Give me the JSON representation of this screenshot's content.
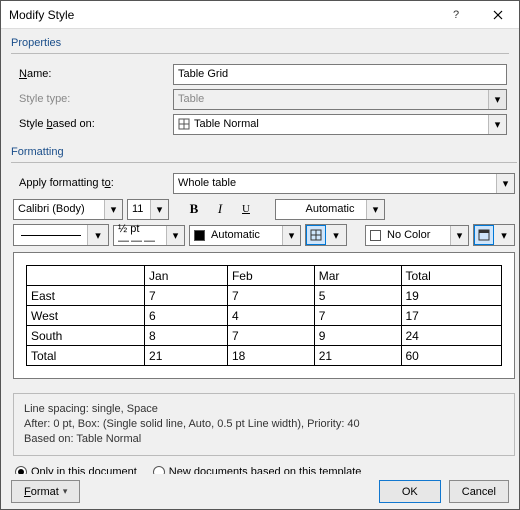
{
  "title": "Modify Style",
  "sections": {
    "properties": "Properties",
    "formatting": "Formatting"
  },
  "fields": {
    "name_label_pre": "N",
    "name_label_rest": "ame:",
    "name_value": "Table Grid",
    "type_label": "Style type:",
    "type_value": "Table",
    "based_label_pre": "Style ",
    "based_label_u": "b",
    "based_label_rest": "ased on:",
    "based_value": "Table Normal",
    "apply_label_pre": "Apply formatting t",
    "apply_label_u": "o",
    "apply_label_rest": ":",
    "apply_value": "Whole table"
  },
  "font": {
    "family": "Calibri (Body)",
    "size": "11"
  },
  "color_auto": "Automatic",
  "border": {
    "weight": "½ pt",
    "color_label": "Automatic",
    "fill": "No Color"
  },
  "preview": {
    "headers": [
      "",
      "Jan",
      "Feb",
      "Mar",
      "Total"
    ],
    "rows": [
      [
        "East",
        "7",
        "7",
        "5",
        "19"
      ],
      [
        "West",
        "6",
        "4",
        "7",
        "17"
      ],
      [
        "South",
        "8",
        "7",
        "9",
        "24"
      ],
      [
        "Total",
        "21",
        "18",
        "21",
        "60"
      ]
    ]
  },
  "desc": {
    "l1": "Line spacing:  single, Space",
    "l2": "After:  0 pt, Box: (Single solid line, Auto,  0.5 pt Line width), Priority: 40",
    "l3": "Based on: Table Normal"
  },
  "radios": {
    "doc": "Only in this document",
    "tmpl": "New documents based on this template"
  },
  "buttons": {
    "format": "Format",
    "ok": "OK",
    "cancel": "Cancel"
  }
}
